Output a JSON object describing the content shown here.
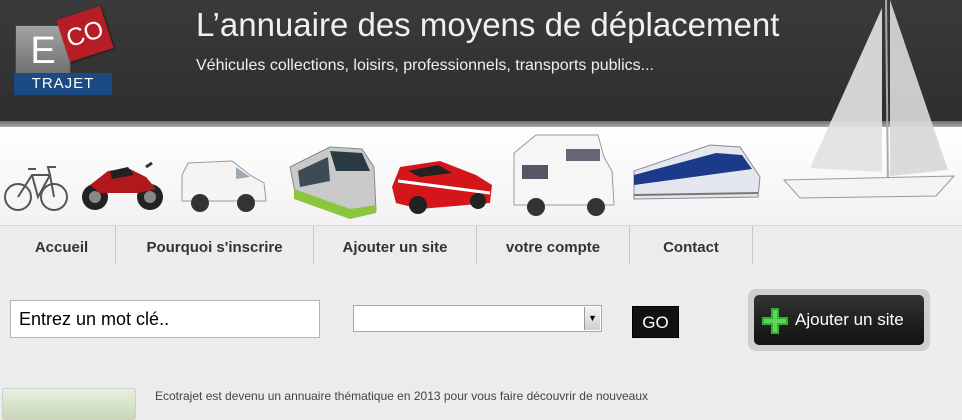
{
  "header": {
    "logo": {
      "e": "E",
      "co": "CO",
      "trajet": "TRAJET"
    },
    "title": "L’annuaire des moyens de déplacement",
    "subtitle": "Véhicules collections, loisirs, professionnels, transports publics..."
  },
  "nav": {
    "items": [
      {
        "label": "Accueil"
      },
      {
        "label": "Pourquoi s'inscrire"
      },
      {
        "label": "Ajouter un site"
      },
      {
        "label": "votre compte"
      },
      {
        "label": "Contact"
      }
    ]
  },
  "search": {
    "keyword_value": "Entrez un mot clé..",
    "category_value": "",
    "go_label": "GO"
  },
  "add_site": {
    "label": "Ajouter un site",
    "icon": "plus-icon"
  },
  "intro_text": "Ecotrajet est devenu un annuaire thématique en 2013 pour vous faire découvrir de nouveaux",
  "colors": {
    "header_bg": "#333333",
    "logo_red": "#b71d24",
    "logo_blue": "#1b4b82",
    "plus_green": "#2fb52b",
    "tram_green": "#8cc63f"
  }
}
